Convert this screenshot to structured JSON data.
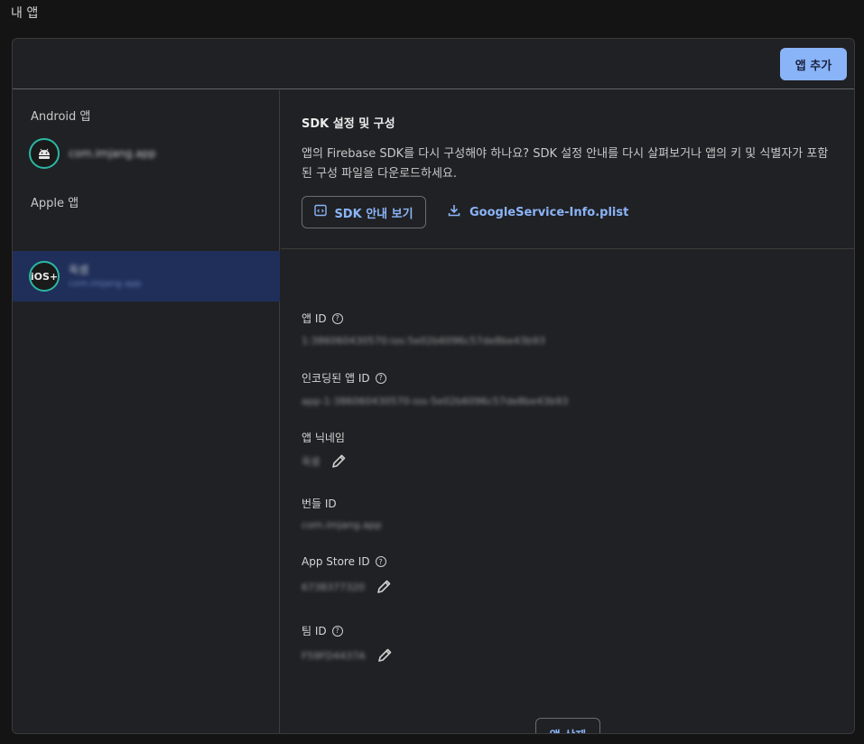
{
  "page": {
    "title": "내 앱"
  },
  "header": {
    "add_app_label": "앱 추가"
  },
  "sidebar": {
    "android": {
      "label": "Android 앱",
      "apps": [
        {
          "name": "com.imjang.app",
          "icon": "android-icon"
        }
      ]
    },
    "apple": {
      "label": "Apple 앱",
      "apps": [
        {
          "name": "옥셈",
          "bundle": "com.imjang.app",
          "icon": "ios-icon",
          "icon_text": "iOS+",
          "selected": true
        }
      ]
    }
  },
  "sdk": {
    "title": "SDK 설정 및 구성",
    "description": "앱의 Firebase SDK를 다시 구성해야 하나요? SDK 설정 안내를 다시 살펴보거나 앱의 키 및 식별자가 포함된 구성 파일을 다운로드하세요.",
    "guide_button": "SDK 안내 보기",
    "download_link": "GoogleService-Info.plist"
  },
  "fields": {
    "app_id": {
      "label": "앱 ID",
      "value": "1:386060430570:ios:5e02b6096c57de8be43b93"
    },
    "encoded_app_id": {
      "label": "인코딩된 앱 ID",
      "value": "app-1-386060430570-ios-5e02b6096c57de8be43b93"
    },
    "nickname": {
      "label": "앱 닉네임",
      "value": "옥셈"
    },
    "bundle_id": {
      "label": "번들 ID",
      "value": "com.imjang.app"
    },
    "app_store_id": {
      "label": "App Store ID",
      "value": "6738377320"
    },
    "team_id": {
      "label": "팀 ID",
      "value": "F59FD4437A"
    }
  },
  "delete_button": "앱 삭제",
  "colors": {
    "accent": "#8ab4f8",
    "selected_bg": "#1f2f5a",
    "avatar_ring": "#2bb7a4"
  }
}
